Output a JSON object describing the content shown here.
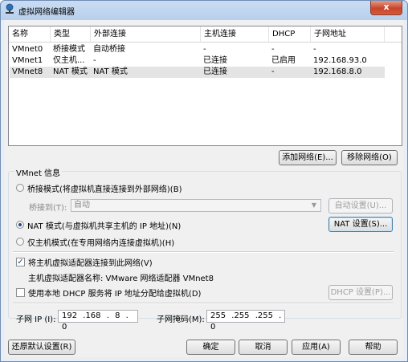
{
  "window": {
    "title": "虚拟网络编辑器",
    "close_label": "x"
  },
  "table": {
    "columns": [
      "名称",
      "类型",
      "外部连接",
      "主机连接",
      "DHCP",
      "子网地址"
    ],
    "rows": [
      {
        "name": "VMnet0",
        "type": "桥接模式",
        "external": "自动桥接",
        "host": "-",
        "dhcp": "-",
        "subnet": "-"
      },
      {
        "name": "VMnet1",
        "type": "仅主机...",
        "external": "-",
        "host": "已连接",
        "dhcp": "已启用",
        "subnet": "192.168.93.0"
      },
      {
        "name": "VMnet8",
        "type": "NAT 模式",
        "external": "NAT 模式",
        "host": "已连接",
        "dhcp": "-",
        "subnet": "192.168.8.0"
      }
    ],
    "selected_row": 2
  },
  "buttons": {
    "add_network": "添加网络(E)...",
    "remove_network": "移除网络(O)",
    "auto_settings": "自动设置(U)...",
    "nat_settings": "NAT 设置(S)...",
    "dhcp_settings": "DHCP 设置(P)...",
    "restore_defaults": "还原默认设置(R)",
    "ok": "确定",
    "cancel": "取消",
    "apply": "应用(A)",
    "help": "帮助"
  },
  "vmnet_info": {
    "group_label": "VMnet 信息",
    "bridged_label": "桥接模式(将虚拟机直接连接到外部网络)(B)",
    "bridged_to_label": "桥接到(T):",
    "bridged_to_value": "自动",
    "nat_label": "NAT 模式(与虚拟机共享主机的 IP 地址)(N)",
    "hostonly_label": "仅主机模式(在专用网络内连接虚拟机)(H)",
    "selected_mode": "nat",
    "connect_adapter_label": "将主机虚拟适配器连接到此网络(V)",
    "connect_adapter_checked": true,
    "adapter_name_label": "主机虚拟适配器名称: VMware 网络适配器 VMnet8",
    "use_dhcp_label": "使用本地 DHCP 服务将 IP 地址分配给虚拟机(D)",
    "use_dhcp_checked": false,
    "subnet_ip_label": "子网 IP (I):",
    "subnet_ip_value": "192 .168 . 8 . 0",
    "subnet_mask_label": "子网掩码(M):",
    "subnet_mask_value": "255 .255 .255 . 0"
  }
}
